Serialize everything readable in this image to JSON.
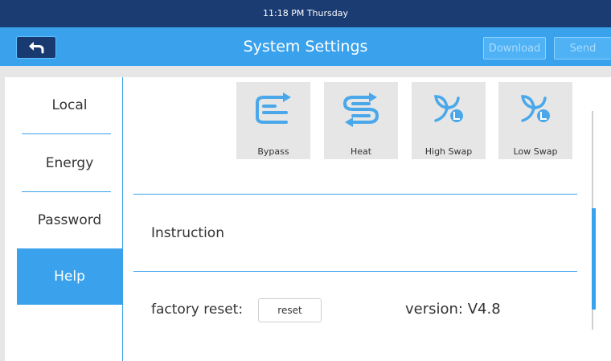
{
  "status_bar": {
    "clock": "11:18 PM Thursday"
  },
  "header": {
    "title": "System Settings",
    "back_icon": "back-arrow-icon",
    "download_label": "Download",
    "send_label": "Send"
  },
  "sidebar": {
    "items": [
      {
        "label": "Local",
        "active": false
      },
      {
        "label": "Energy",
        "active": false
      },
      {
        "label": "Password",
        "active": false
      },
      {
        "label": "Help",
        "active": true
      }
    ]
  },
  "modes": [
    {
      "label": "Bypass",
      "icon": "bypass-icon"
    },
    {
      "label": "Heat",
      "icon": "heat-exchange-icon"
    },
    {
      "label": "High Swap",
      "icon": "fan-high-icon"
    },
    {
      "label": "Low Swap",
      "icon": "fan-low-icon"
    }
  ],
  "help": {
    "instruction_label": "Instruction",
    "factory_reset_label": "factory reset:",
    "reset_button_label": "reset",
    "version_label": "version:  V4.8"
  },
  "colors": {
    "accent": "#3aa2ec",
    "status_bar": "#1a3c72",
    "icon": "#4aa8ea"
  }
}
